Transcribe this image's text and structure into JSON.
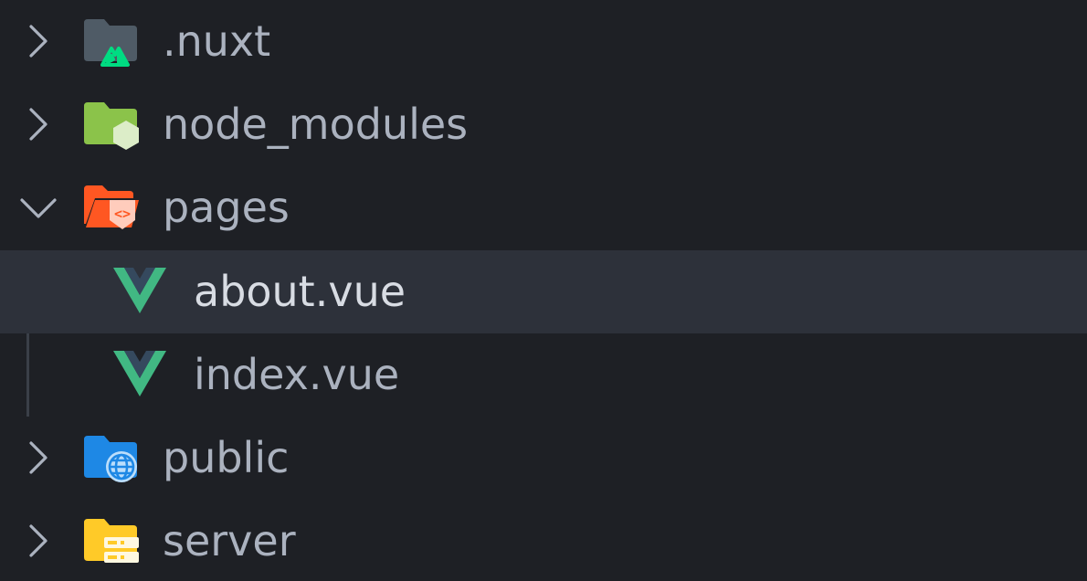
{
  "explorer": {
    "items": [
      {
        "label": ".nuxt",
        "type": "folder",
        "expanded": false,
        "icon": "nuxt-folder-icon",
        "color": "#4f5b66",
        "accent": "#00dc82"
      },
      {
        "label": "node_modules",
        "type": "folder",
        "expanded": false,
        "icon": "node-folder-icon",
        "color": "#8bc34a",
        "accent": "#dcedc8"
      },
      {
        "label": "pages",
        "type": "folder",
        "expanded": true,
        "icon": "pages-folder-icon",
        "color": "#ff5722",
        "accent": "#ffccbc"
      },
      {
        "label": "about.vue",
        "type": "file",
        "selected": true,
        "icon": "vue-file-icon",
        "color": "#41b883",
        "accent": "#35495e"
      },
      {
        "label": "index.vue",
        "type": "file",
        "selected": false,
        "icon": "vue-file-icon",
        "color": "#41b883",
        "accent": "#35495e"
      },
      {
        "label": "public",
        "type": "folder",
        "expanded": false,
        "icon": "public-folder-icon",
        "color": "#1e88e5",
        "accent": "#bbdefb"
      },
      {
        "label": "server",
        "type": "folder",
        "expanded": false,
        "icon": "server-folder-icon",
        "color": "#ffca28",
        "accent": "#fff8e1"
      }
    ]
  }
}
